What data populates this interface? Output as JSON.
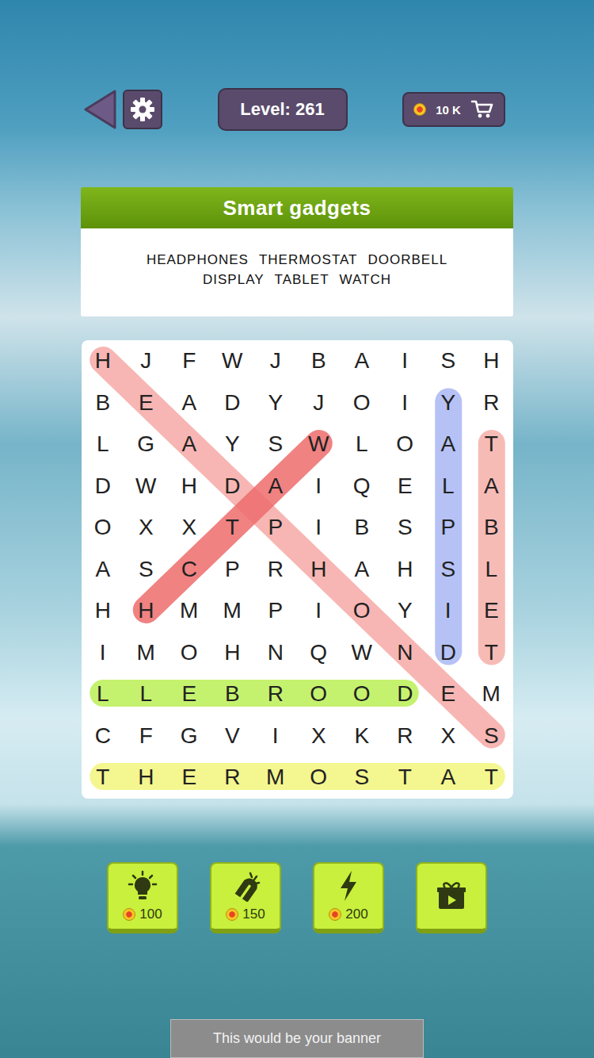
{
  "top_bar": {
    "level": "Level: 261",
    "coins": "10 K"
  },
  "category": {
    "title": "Smart gadgets",
    "word_lines": [
      [
        "HEADPHONES",
        "THERMOSTAT",
        "DOORBELL"
      ],
      [
        "DISPLAY",
        "TABLET",
        "WATCH"
      ]
    ]
  },
  "grid": {
    "rows": [
      [
        "H",
        "J",
        "F",
        "W",
        "J",
        "B",
        "A",
        "I",
        "S",
        "H"
      ],
      [
        "B",
        "E",
        "A",
        "D",
        "Y",
        "J",
        "O",
        "I",
        "Y",
        "R"
      ],
      [
        "L",
        "G",
        "A",
        "Y",
        "S",
        "W",
        "L",
        "O",
        "A",
        "T"
      ],
      [
        "D",
        "W",
        "H",
        "D",
        "A",
        "I",
        "Q",
        "E",
        "L",
        "A"
      ],
      [
        "O",
        "X",
        "X",
        "T",
        "P",
        "I",
        "B",
        "S",
        "P",
        "B"
      ],
      [
        "A",
        "S",
        "C",
        "P",
        "R",
        "H",
        "A",
        "H",
        "S",
        "L"
      ],
      [
        "H",
        "H",
        "M",
        "M",
        "P",
        "I",
        "O",
        "Y",
        "I",
        "E"
      ],
      [
        "I",
        "M",
        "O",
        "H",
        "N",
        "Q",
        "W",
        "N",
        "D",
        "T"
      ],
      [
        "L",
        "L",
        "E",
        "B",
        "R",
        "O",
        "O",
        "D",
        "E",
        "M"
      ],
      [
        "C",
        "F",
        "G",
        "V",
        "I",
        "X",
        "K",
        "R",
        "X",
        "S"
      ],
      [
        "T",
        "H",
        "E",
        "R",
        "M",
        "O",
        "S",
        "T",
        "A",
        "T"
      ]
    ]
  },
  "highlights": [
    {
      "from": [
        0,
        0
      ],
      "to": [
        9,
        9
      ],
      "color": "#f6aaa6"
    },
    {
      "from": [
        2,
        5
      ],
      "to": [
        6,
        1
      ],
      "color": "#ee6d6d"
    },
    {
      "from": [
        7,
        8
      ],
      "to": [
        1,
        8
      ],
      "color": "#aab8f4"
    },
    {
      "from": [
        2,
        9
      ],
      "to": [
        7,
        9
      ],
      "color": "#f6b0aa"
    },
    {
      "from": [
        8,
        7
      ],
      "to": [
        8,
        0
      ],
      "color": "#bcf055"
    },
    {
      "from": [
        10,
        0
      ],
      "to": [
        10,
        9
      ],
      "color": "#f3f57c"
    }
  ],
  "boosters": [
    {
      "kind": "hint",
      "price": "100"
    },
    {
      "kind": "magnet",
      "price": "150"
    },
    {
      "kind": "lightning",
      "price": "200"
    },
    {
      "kind": "video"
    }
  ],
  "banner": "This would be your banner"
}
